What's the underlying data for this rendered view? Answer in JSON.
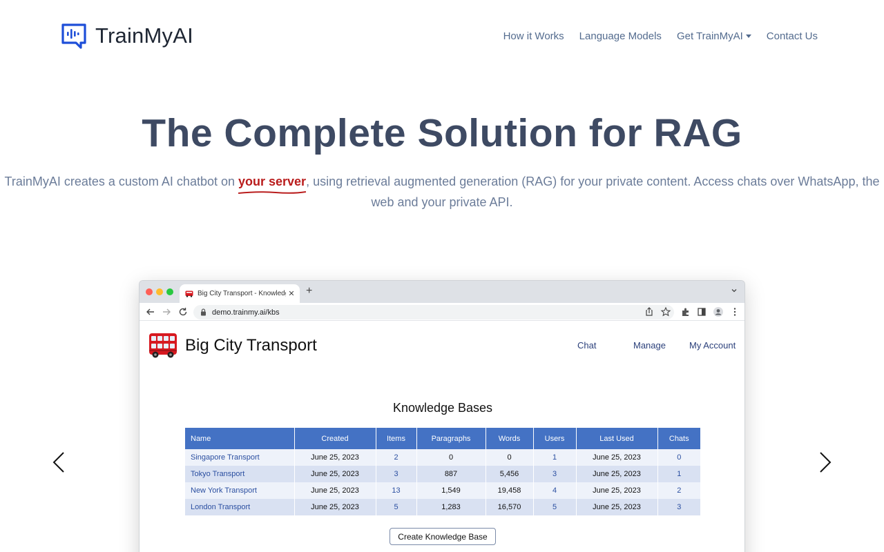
{
  "header": {
    "brand": "TrainMyAI",
    "nav": [
      {
        "label": "How it Works"
      },
      {
        "label": "Language Models"
      },
      {
        "label": "Get TrainMyAI",
        "dropdown": true
      },
      {
        "label": "Contact Us"
      }
    ]
  },
  "hero": {
    "title": "The Complete Solution for RAG",
    "subtitle_before": "TrainMyAI creates a custom AI chatbot on ",
    "subtitle_highlight": "your server",
    "subtitle_after": ", using retrieval augmented generation (RAG) for your private content. Access chats over WhatsApp, the web and your private API."
  },
  "carousel": {
    "prev_icon": "chevron-left-icon",
    "next_icon": "chevron-right-icon"
  },
  "browser": {
    "tab_title": "Big City Transport - Knowledge",
    "url": "demo.trainmy.ai/kbs",
    "app": {
      "title": "Big City Transport",
      "nav": {
        "chat": "Chat",
        "manage": "Manage",
        "account": "My Account"
      },
      "kb_heading": "Knowledge Bases",
      "table": {
        "headers": [
          "Name",
          "Created",
          "Items",
          "Paragraphs",
          "Words",
          "Users",
          "Last Used",
          "Chats"
        ],
        "rows": [
          [
            "Singapore Transport",
            "June 25, 2023",
            "2",
            "0",
            "0",
            "1",
            "June 25, 2023",
            "0"
          ],
          [
            "Tokyo Transport",
            "June 25, 2023",
            "3",
            "887",
            "5,456",
            "3",
            "June 25, 2023",
            "1"
          ],
          [
            "New York Transport",
            "June 25, 2023",
            "13",
            "1,549",
            "19,458",
            "4",
            "June 25, 2023",
            "2"
          ],
          [
            "London Transport",
            "June 25, 2023",
            "5",
            "1,283",
            "16,570",
            "5",
            "June 25, 2023",
            "3"
          ]
        ]
      },
      "create_button": "Create Knowledge Base"
    }
  },
  "colors": {
    "brand_blue": "#1d4ed8",
    "title": "#3e4a63",
    "subtitle": "#6b7c99",
    "highlight_red": "#b91c1c",
    "table_header": "#4472c4",
    "row_odd": "#eef2fa",
    "row_even": "#d9e1f2"
  }
}
